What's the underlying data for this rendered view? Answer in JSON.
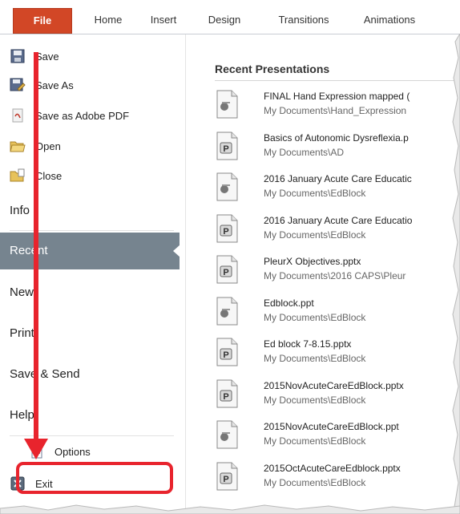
{
  "ribbon": {
    "tabs": [
      "File",
      "Home",
      "Insert",
      "Design",
      "Transitions",
      "Animations"
    ]
  },
  "backstage": {
    "save": "Save",
    "save_as": "Save As",
    "save_as_pdf": "Save as Adobe PDF",
    "open": "Open",
    "close": "Close",
    "info": "Info",
    "recent": "Recent",
    "new": "New",
    "print": "Print",
    "save_send": "Save & Send",
    "help": "Help",
    "options": "Options",
    "exit": "Exit"
  },
  "recent": {
    "title": "Recent Presentations",
    "files": [
      {
        "name": "FINAL Hand Expression mapped (",
        "path": "My Documents\\Hand_Expression",
        "icon": "ppt-old-icon"
      },
      {
        "name": "Basics of Autonomic Dysreflexia.p",
        "path": "My Documents\\AD",
        "icon": "pptx-icon"
      },
      {
        "name": "2016 January Acute Care Educatic",
        "path": "My Documents\\EdBlock",
        "icon": "ppt-old-icon"
      },
      {
        "name": "2016 January Acute Care Educatio",
        "path": "My Documents\\EdBlock",
        "icon": "pptx-icon"
      },
      {
        "name": "PleurX Objectives.pptx",
        "path": "My Documents\\2016 CAPS\\Pleur",
        "icon": "pptx-icon"
      },
      {
        "name": "Edblock.ppt",
        "path": "My Documents\\EdBlock",
        "icon": "ppt-old-icon"
      },
      {
        "name": "Ed block 7-8.15.pptx",
        "path": "My Documents\\EdBlock",
        "icon": "pptx-icon"
      },
      {
        "name": "2015NovAcuteCareEdBlock.pptx",
        "path": "My Documents\\EdBlock",
        "icon": "pptx-icon"
      },
      {
        "name": "2015NovAcuteCareEdBlock.ppt",
        "path": "My Documents\\EdBlock",
        "icon": "ppt-old-icon"
      },
      {
        "name": "2015OctAcuteCareEdblock.pptx",
        "path": "My Documents\\EdBlock",
        "icon": "pptx-icon"
      }
    ]
  },
  "colors": {
    "file_tab": "#d24726",
    "recent_selected": "#76848f",
    "annotation_red": "#e8242d"
  }
}
